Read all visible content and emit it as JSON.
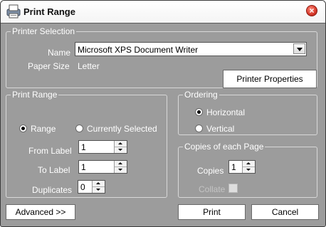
{
  "window": {
    "title": "Print Range",
    "close_icon": "close-icon"
  },
  "printer_selection": {
    "legend": "Printer Selection",
    "name_label": "Name",
    "name_value": "Microsoft XPS Document Writer",
    "paper_size_label": "Paper Size",
    "paper_size_value": "Letter",
    "properties_button": "Printer Properties"
  },
  "print_range": {
    "legend": "Print Range",
    "range_option": "Range",
    "currently_selected_option": "Currently Selected",
    "selected": "Range",
    "from_label": "From Label",
    "from_value": "1",
    "to_label": "To Label",
    "to_value": "1",
    "duplicates_label": "Duplicates",
    "duplicates_value": "0"
  },
  "ordering": {
    "legend": "Ordering",
    "horizontal_option": "Horizontal",
    "vertical_option": "Vertical",
    "selected": "Horizontal"
  },
  "copies": {
    "legend": "Copies of each Page",
    "copies_label": "Copies",
    "copies_value": "1",
    "collate_label": "Collate",
    "collate_checked": false
  },
  "buttons": {
    "advanced": "Advanced >>",
    "print": "Print",
    "cancel": "Cancel"
  }
}
